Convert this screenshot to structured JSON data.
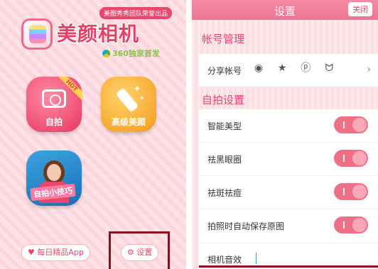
{
  "left": {
    "badge": "美图秀秀团队荣誉出品",
    "logo_text": "美颜相机",
    "sub": "360独家首发",
    "tiles": {
      "selfie": {
        "label": "自拍",
        "hot": "HOT"
      },
      "advanced": {
        "label": "高级美颜"
      },
      "tips": {
        "label": "自拍小技巧"
      }
    },
    "daily_app": "♥ 每日精品App",
    "settings": "⚙ 设置"
  },
  "right": {
    "title": "设置",
    "close": "关闭",
    "account_section": "帐号管理",
    "share_label": "分享帐号",
    "share_icons": [
      "weibo-icon",
      "star-icon",
      "qq-space-icon",
      "renren-icon"
    ],
    "selfie_section": "自拍设置",
    "toggles": [
      {
        "label": "智能美型",
        "on": true
      },
      {
        "label": "祛黑眼圈",
        "on": true
      },
      {
        "label": "祛斑祛痘",
        "on": true
      },
      {
        "label": "拍照时自动保存原图",
        "on": true
      }
    ],
    "camera_sound": "相机音效"
  },
  "colors": {
    "accent": "#e8466a",
    "toggle_on": "#ef6f87",
    "header": "#f58aa2"
  }
}
